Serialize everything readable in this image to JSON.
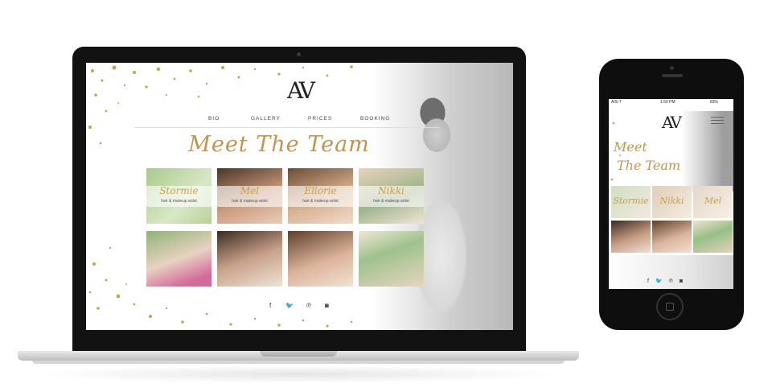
{
  "laptop": {
    "logo": "AV",
    "nav": [
      {
        "label": "BIO"
      },
      {
        "label": "GALLERY"
      },
      {
        "label": "PRICES"
      },
      {
        "label": "BOOKING"
      }
    ],
    "headline": "Meet The Team",
    "team": [
      {
        "name": "Stormie",
        "role": "hair & makeup artist"
      },
      {
        "name": "Mel",
        "role": "hair & makeup artist"
      },
      {
        "name": "Ellorie",
        "role": "hair & makeup artist"
      },
      {
        "name": "Nikki",
        "role": "hair & makeup artist"
      }
    ],
    "social_icons": [
      {
        "name": "facebook-icon",
        "glyph": "f"
      },
      {
        "name": "twitter-icon",
        "glyph": "🐦"
      },
      {
        "name": "pinterest-icon",
        "glyph": "℗"
      },
      {
        "name": "instagram-icon",
        "glyph": "◙"
      }
    ]
  },
  "phone": {
    "status": {
      "carrier": "AIS-T",
      "time": "1:50 PM",
      "battery": "83%"
    },
    "logo": "AV",
    "headline_line1": "Meet",
    "headline_line2": "The Team",
    "team": [
      {
        "name": "Stormie"
      },
      {
        "name": "Nikki"
      },
      {
        "name": "Mel"
      }
    ]
  },
  "colors": {
    "accent_gold": "#c2954a",
    "text_dark": "#222222",
    "device_black": "#121212"
  }
}
